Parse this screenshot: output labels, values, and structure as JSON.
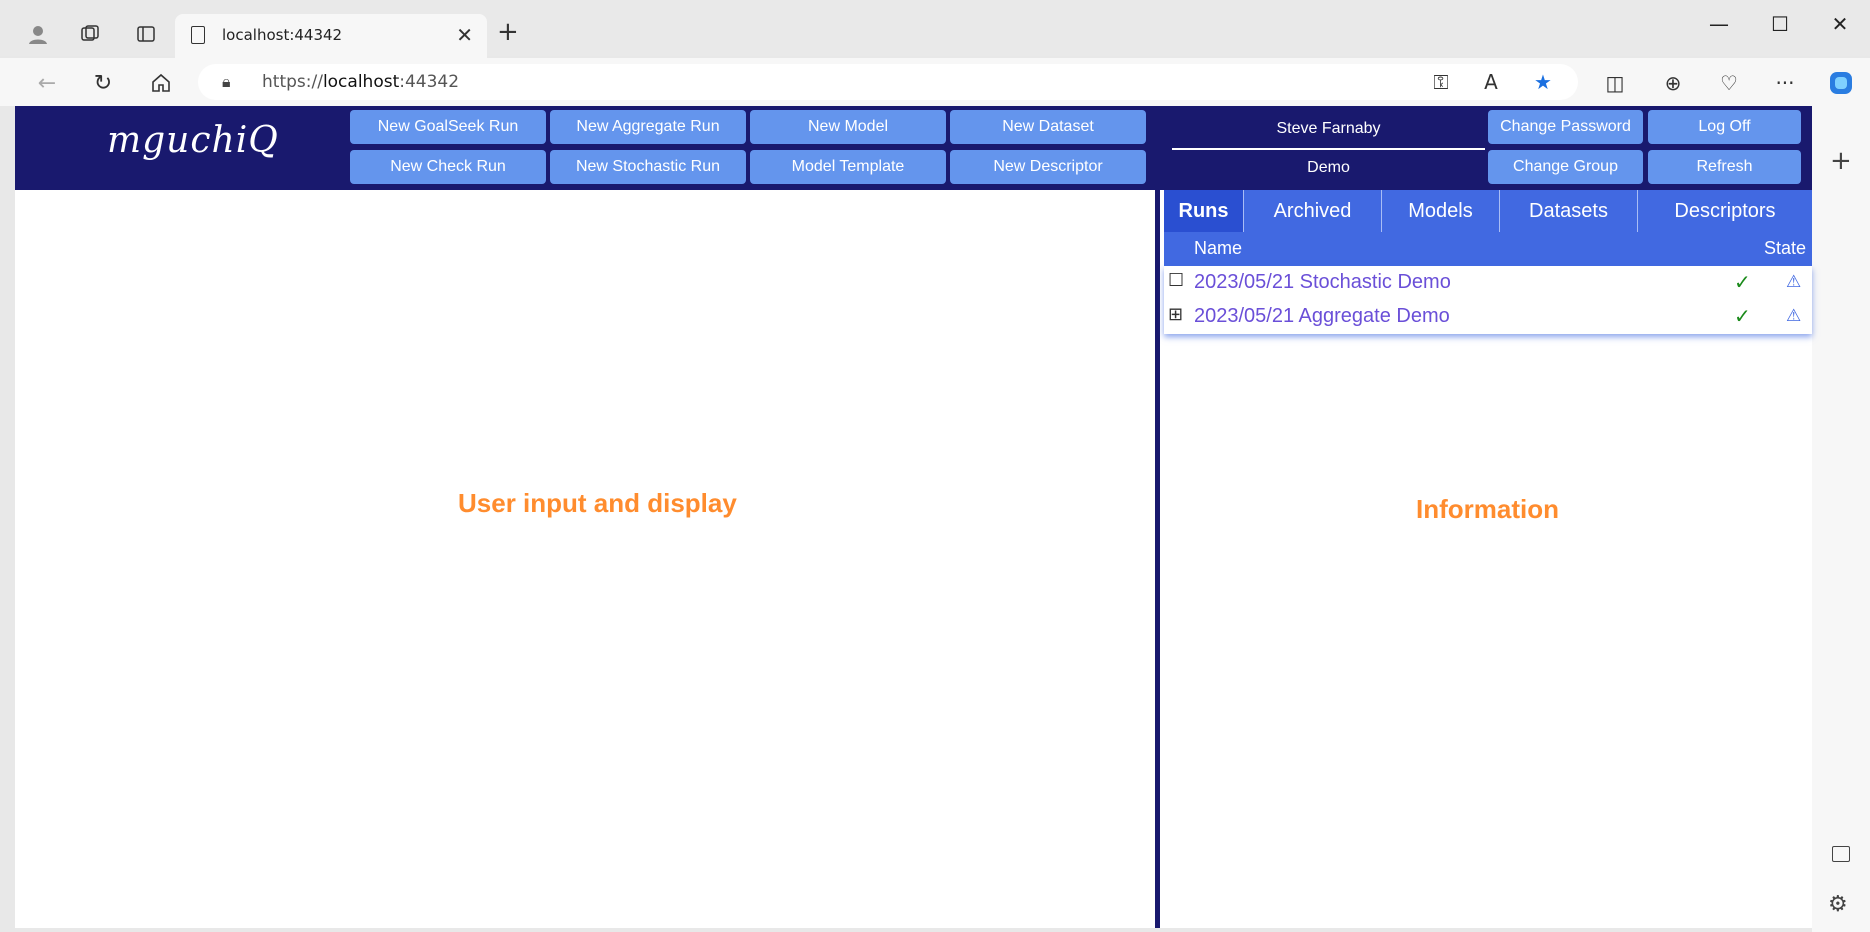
{
  "browser": {
    "tab_title": "localhost:44342",
    "url_scheme": "https://",
    "url_host": "localhost",
    "url_port": ":44342"
  },
  "app": {
    "logo": "mguchiQ",
    "buttons_row1": [
      "New GoalSeek Run",
      "New Aggregate Run",
      "New Model",
      "New Dataset"
    ],
    "buttons_row2": [
      "New Check Run",
      "New Stochastic Run",
      "Model Template",
      "New Descriptor"
    ],
    "user_name": "Steve Farnaby",
    "user_group": "Demo",
    "change_password": "Change Password",
    "log_off": "Log Off",
    "change_group": "Change Group",
    "refresh": "Refresh"
  },
  "left_panel": {
    "label": "User input and display"
  },
  "right_panel": {
    "label": "Information",
    "tabs": [
      "Runs",
      "Archived",
      "Models",
      "Datasets",
      "Descriptors"
    ],
    "active_tab": "Runs",
    "columns": {
      "name": "Name",
      "state": "State"
    },
    "runs": [
      {
        "toggle": "☐",
        "name": "2023/05/21 Stochastic Demo",
        "status_icon": "check-icon",
        "alert_icon": "warning-icon"
      },
      {
        "toggle": "⊞",
        "name": "2023/05/21 Aggregate Demo",
        "status_icon": "check-icon",
        "alert_icon": "warning-icon"
      }
    ]
  },
  "colors": {
    "header_bg": "#19196e",
    "button_bg": "#6495ed",
    "tab_bg": "#4169e1",
    "label_orange": "#ff8c2e",
    "run_link": "#6a4fd8"
  }
}
